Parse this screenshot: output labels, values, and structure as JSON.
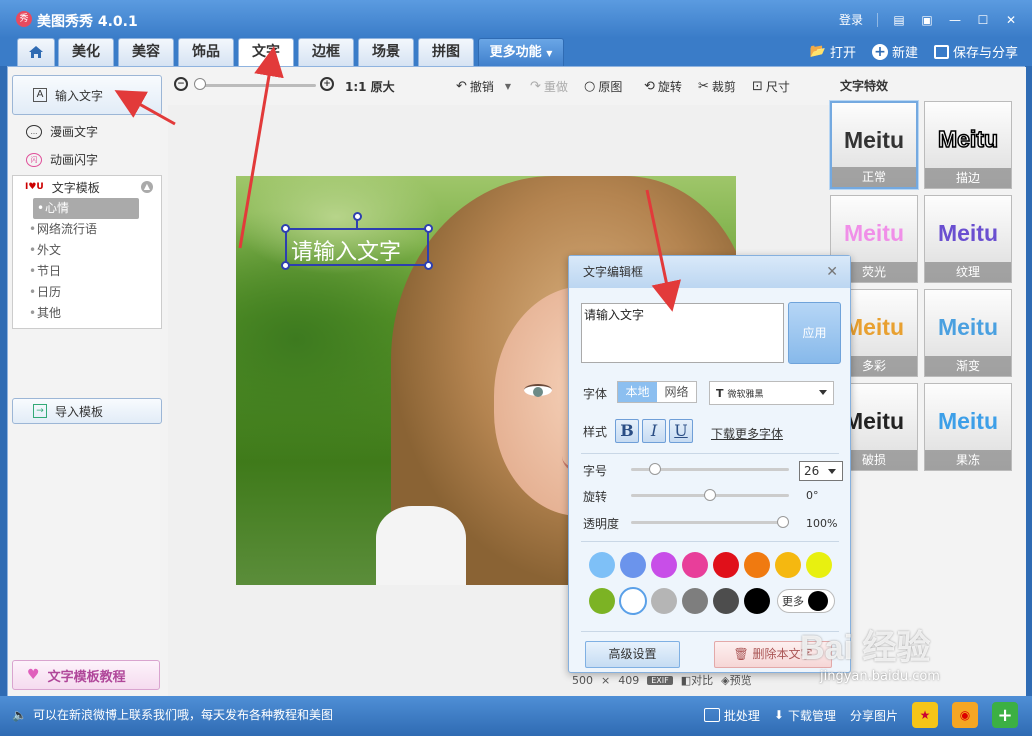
{
  "window": {
    "title": "美图秀秀 4.0.1",
    "login": "登录"
  },
  "tabs": [
    {
      "label": "美化"
    },
    {
      "label": "美容"
    },
    {
      "label": "饰品"
    },
    {
      "label": "文字"
    },
    {
      "label": "边框"
    },
    {
      "label": "场景"
    },
    {
      "label": "拼图"
    },
    {
      "label": "更多功能"
    }
  ],
  "active_tab": "文字",
  "header_actions": {
    "open": "打开",
    "new": "新建",
    "save_share": "保存与分享"
  },
  "left_panel": {
    "input_text": "输入文字",
    "comic_text": "漫画文字",
    "animated_text": "动画闪字",
    "template_title": "文字模板",
    "template_items": [
      "心情",
      "网络流行语",
      "外文",
      "节日",
      "日历",
      "其他"
    ],
    "selected_template": "心情",
    "import_template": "导入模板",
    "tutorial": "文字模板教程"
  },
  "toolbar": {
    "original_size": "1:1 原大",
    "undo": "撤销",
    "redo": "重做",
    "original": "原图",
    "rotate": "旋转",
    "crop": "裁剪",
    "resize": "尺寸",
    "zoom_level": 0.0
  },
  "canvas": {
    "overlay_text": "请输入文字",
    "image_width": "500",
    "image_height": "409",
    "size_sep": "×",
    "exif": "EXIF",
    "compare": "对比",
    "preview": "预览"
  },
  "effects_panel": {
    "title": "文字特效",
    "items": [
      {
        "sample": "Meitu",
        "label": "正常",
        "color": "#333333"
      },
      {
        "sample": "Meitu",
        "label": "描边",
        "color": "#ffffff"
      },
      {
        "sample": "Meitu",
        "label": "荧光",
        "color": "#f08fe8"
      },
      {
        "sample": "Meitu",
        "label": "纹理",
        "color": "#6a4fd0"
      },
      {
        "sample": "Meitu",
        "label": "多彩",
        "color": "#e8a030"
      },
      {
        "sample": "Meitu",
        "label": "渐变",
        "color": "#4aa0e0"
      },
      {
        "sample": "Meitu",
        "label": "破损",
        "color": "#222222"
      },
      {
        "sample": "Meitu",
        "label": "果冻",
        "color": "#3d9fe8"
      }
    ]
  },
  "dialog": {
    "title": "文字编辑框",
    "text_value": "请输入文字",
    "apply": "应用",
    "font_label": "字体",
    "font_local": "本地",
    "font_web": "网络",
    "font_name": "微软雅黑",
    "style_label": "样式",
    "bold": "B",
    "italic": "I",
    "underline": "U",
    "more_fonts": "下载更多字体",
    "size_label": "字号",
    "size_value": "26",
    "size_fraction": 0.12,
    "rotate_label": "旋转",
    "rotate_value": "0°",
    "rotate_fraction": 0.5,
    "opacity_label": "透明度",
    "opacity_value": "100%",
    "opacity_fraction": 1.0,
    "colors_row1": [
      "#7ec0f7",
      "#6b94ec",
      "#c84ee8",
      "#e83e9a",
      "#e0101a",
      "#f07a10",
      "#f5b810",
      "#e8f010"
    ],
    "colors_row2": [
      "#7cb324",
      "#ffffff",
      "#b5b5b5",
      "#7e7e7e",
      "#4d4d4d",
      "#000000"
    ],
    "more_colors": "更多",
    "advanced": "高级设置",
    "delete": "删除本文字"
  },
  "statusbar": {
    "message": "可以在新浪微博上联系我们哦，每天发布各种教程和美图",
    "batch": "批处理",
    "download_manager": "下载管理",
    "share_image": "分享图片"
  },
  "watermark": {
    "main": "Bai 经验",
    "sub": "jingyan.baidu.com"
  }
}
